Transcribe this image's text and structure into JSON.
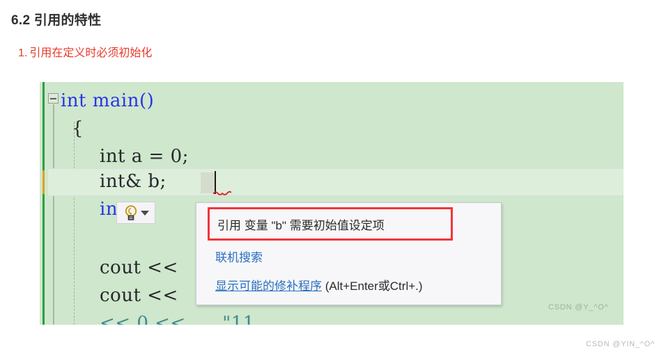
{
  "article": {
    "heading": "6.2 引用的特性",
    "list_marker": "1.",
    "list_text": "引用在定义时必须初始化"
  },
  "editor": {
    "collapse_icon": "collapse-minus-icon",
    "lines": [
      {
        "indent": 0,
        "tokens": [
          {
            "t": "int",
            "c": "kw"
          },
          {
            "t": " ",
            "c": "punct"
          },
          {
            "t": "main",
            "c": "fn"
          },
          {
            "t": "()",
            "c": "punct"
          }
        ]
      },
      {
        "indent": 1,
        "tokens": [
          {
            "t": "{",
            "c": "punct"
          }
        ]
      },
      {
        "indent": 2,
        "tokens": [
          {
            "t": "int",
            "c": "kw"
          },
          {
            "t": " ",
            "c": "punct"
          },
          {
            "t": "a",
            "c": "var"
          },
          {
            "t": " = ",
            "c": "op"
          },
          {
            "t": "0;",
            "c": "punct"
          }
        ]
      }
    ],
    "line_main": "int main()",
    "line_brace": "{",
    "line_int_a": "int a = 0;",
    "line_int_ref": "int& b;",
    "line_int_partial": "int",
    "line_cout_1": "cout <<",
    "line_cout_2": "cout <<",
    "line_cout_3_frag": "<< 0 <<      \"11",
    "caret_after": "b",
    "watermark_inner": "CSDN @Y_^O^"
  },
  "tooltip": {
    "error_message": "引用 变量 \"b\" 需要初始值设定项",
    "link_search": "联机搜索",
    "link_fixes": "显示可能的修补程序",
    "shortcut": " (Alt+Enter或Ctrl+.)",
    "lightbulb_icon": "lightbulb-icon",
    "chevron_icon": "chevron-down-icon"
  },
  "page": {
    "watermark": "CSDN @YIN_^O^"
  },
  "colors": {
    "error_red": "#f5333a",
    "link_blue": "#2a6fbf",
    "list_red": "#e8392a",
    "editor_bg": "#cfe7cc",
    "keyword_blue": "#2b34e8",
    "change_bar_green": "#2f9e44",
    "change_bar_orange": "#dfa024"
  }
}
